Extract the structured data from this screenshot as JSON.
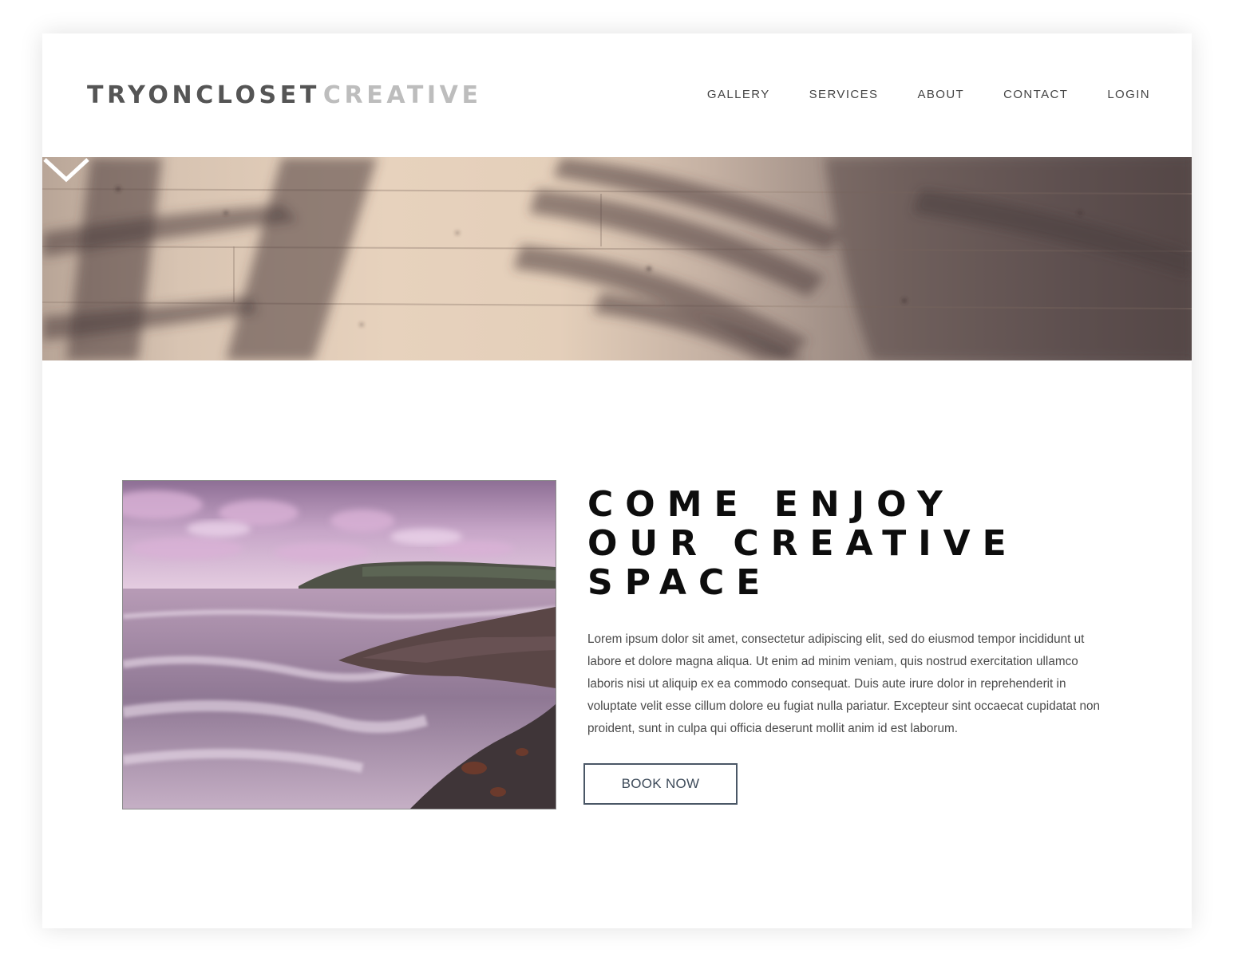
{
  "header": {
    "logo_primary": "TRYONCLOSET",
    "logo_secondary": "CREATIVE",
    "nav": [
      {
        "label": "GALLERY"
      },
      {
        "label": "SERVICES"
      },
      {
        "label": "ABOUT"
      },
      {
        "label": "CONTACT"
      },
      {
        "label": "LOGIN"
      }
    ]
  },
  "hero": {
    "scroll_icon": "chevron-down-icon"
  },
  "main": {
    "image_subject": "misty purple seascape with headland",
    "headline": "COME ENJOY OUR CREATIVE SPACE",
    "body": "Lorem ipsum dolor sit amet, consectetur adipiscing elit, sed do eiusmod tempor incididunt ut labore et dolore magna aliqua. Ut enim ad minim veniam, quis nostrud exercitation ullamco laboris nisi ut aliquip ex ea commodo consequat. Duis aute irure dolor in reprehenderit in voluptate velit esse cillum dolore eu fugiat nulla pariatur. Excepteur sint occaecat cupidatat non proident, sunt in culpa qui officia deserunt mollit anim id est laborum.",
    "cta_label": "BOOK NOW"
  },
  "colors": {
    "logo_dark": "#555555",
    "logo_light": "#bdbdbd",
    "nav_text": "#444444",
    "headline": "#0d0d0d",
    "button_border": "#4a5766"
  }
}
